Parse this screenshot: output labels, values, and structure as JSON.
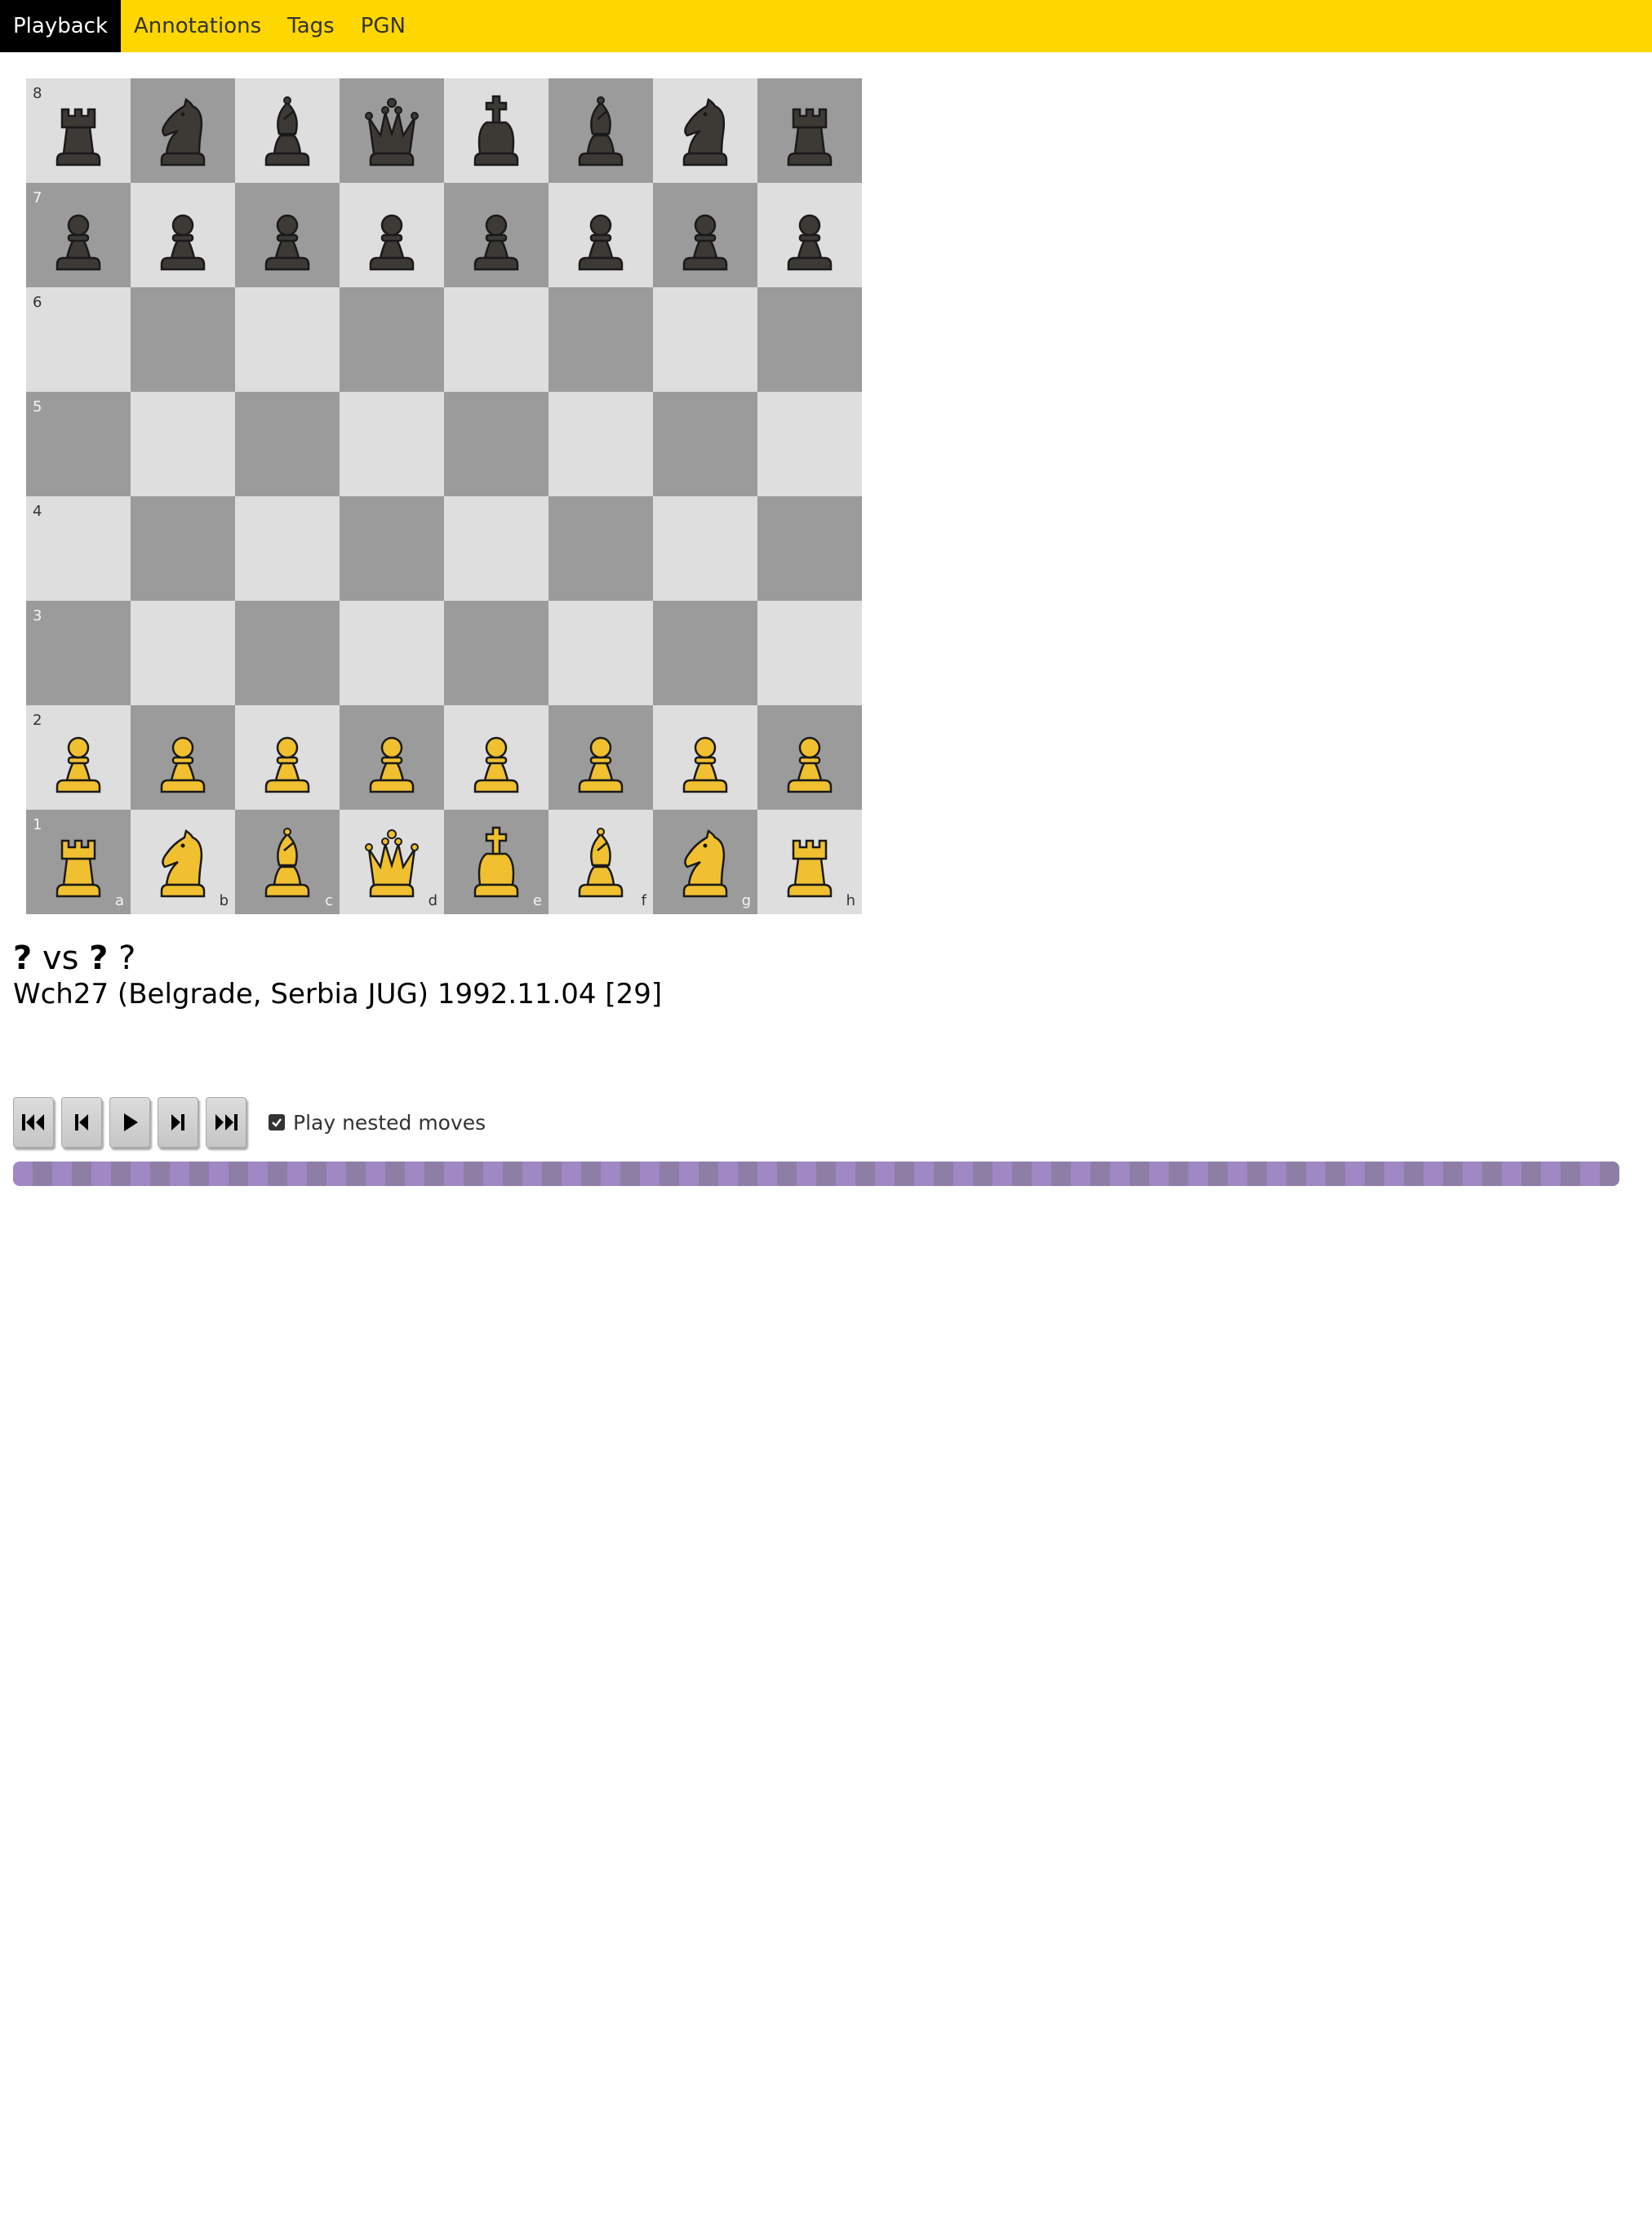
{
  "nav": {
    "tabs": [
      {
        "label": "Playback",
        "active": true
      },
      {
        "label": "Annotations",
        "active": false
      },
      {
        "label": "Tags",
        "active": false
      },
      {
        "label": "PGN",
        "active": false
      }
    ]
  },
  "board": {
    "files": [
      "a",
      "b",
      "c",
      "d",
      "e",
      "f",
      "g",
      "h"
    ],
    "ranks": [
      "8",
      "7",
      "6",
      "5",
      "4",
      "3",
      "2",
      "1"
    ],
    "position": [
      [
        "bR",
        "bN",
        "bB",
        "bQ",
        "bK",
        "bB",
        "bN",
        "bR"
      ],
      [
        "bP",
        "bP",
        "bP",
        "bP",
        "bP",
        "bP",
        "bP",
        "bP"
      ],
      [
        "",
        "",
        "",
        "",
        "",
        "",
        "",
        ""
      ],
      [
        "",
        "",
        "",
        "",
        "",
        "",
        "",
        ""
      ],
      [
        "",
        "",
        "",
        "",
        "",
        "",
        "",
        ""
      ],
      [
        "",
        "",
        "",
        "",
        "",
        "",
        "",
        ""
      ],
      [
        "wP",
        "wP",
        "wP",
        "wP",
        "wP",
        "wP",
        "wP",
        "wP"
      ],
      [
        "wR",
        "wN",
        "wB",
        "wQ",
        "wK",
        "wB",
        "wN",
        "wR"
      ]
    ],
    "colors": {
      "light": "#dedede",
      "dark": "#9b9b9b",
      "white_piece": "#f0c030",
      "black_piece": "#3d3a36"
    }
  },
  "game": {
    "white": "?",
    "vs": "vs",
    "black": "?",
    "result": "?",
    "event_line": "Wch27 (Belgrade, Serbia JUG) 1992.11.04 [29]"
  },
  "controls": {
    "buttons": [
      "first-move-icon",
      "previous-move-icon",
      "play-icon",
      "next-move-icon",
      "last-move-icon"
    ],
    "nested_label": "Play nested moves",
    "nested_checked": true
  },
  "accent": {
    "nav_bg": "#ffd700",
    "progress": "#a088c4"
  }
}
